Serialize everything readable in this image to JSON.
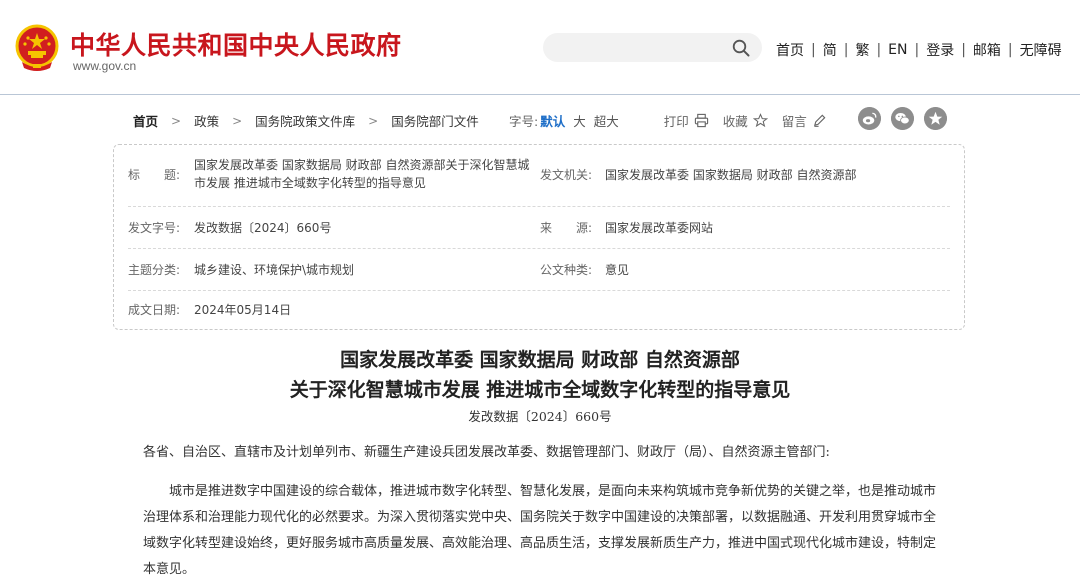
{
  "header": {
    "site_title": "中华人民共和国中央人民政府",
    "site_url": "www.gov.cn",
    "search_placeholder": "",
    "nav": [
      "首页",
      "简",
      "繁",
      "EN",
      "登录",
      "邮箱",
      "无障碍"
    ],
    "nav_separator": "|"
  },
  "breadcrumb": {
    "items": [
      "首页",
      "政策",
      "国务院政策文件库",
      "国务院部门文件"
    ],
    "arrow": ">"
  },
  "toolbar": {
    "font_size_label": "字号:",
    "font_sizes": [
      "默认",
      "大",
      "超大"
    ],
    "selected_font_size": "默认",
    "print": "打印",
    "favorite": "收藏",
    "comment": "留言"
  },
  "share_icons": [
    "weibo-icon",
    "wechat-icon",
    "star-icon"
  ],
  "info": {
    "title_label": "标　　题:",
    "title_value": "国家发展改革委 国家数据局 财政部 自然资源部关于深化智慧城市发展 推进城市全域数字化转型的指导意见",
    "issuer_label": "发文机关:",
    "issuer_value": "国家发展改革委 国家数据局 财政部 自然资源部",
    "docno_label": "发文字号:",
    "docno_value": "发改数据〔2024〕660号",
    "source_label": "来　　源:",
    "source_value": "国家发展改革委网站",
    "topic_label": "主题分类:",
    "topic_value": "城乡建设、环境保护\\城市规划",
    "type_label": "公文种类:",
    "type_value": "意见",
    "date_label": "成文日期:",
    "date_value": "2024年05月14日"
  },
  "article": {
    "title_line1": "国家发展改革委 国家数据局 财政部 自然资源部",
    "title_line2": "关于深化智慧城市发展 推进城市全域数字化转型的指导意见",
    "doc_number": "发改数据〔2024〕660号",
    "salutation": "各省、自治区、直辖市及计划单列市、新疆生产建设兵团发展改革委、数据管理部门、财政厅（局）、自然资源主管部门:",
    "paragraph1": "城市是推进数字中国建设的综合载体，推进城市数字化转型、智慧化发展，是面向未来构筑城市竞争新优势的关键之举，也是推动城市治理体系和治理能力现代化的必然要求。为深入贯彻落实党中央、国务院关于数字中国建设的决策部署，以数据融通、开发利用贯穿城市全域数字化转型建设始终，更好服务城市高质量发展、高效能治理、高品质生活，支撑发展新质生产力，推进中国式现代化城市建设，特制定本意见。"
  },
  "colors": {
    "brand_red": "#c8161d",
    "link_blue": "#1f6fc8",
    "emblem_gold": "#f5c400",
    "icon_gray": "#8d8d8d"
  }
}
